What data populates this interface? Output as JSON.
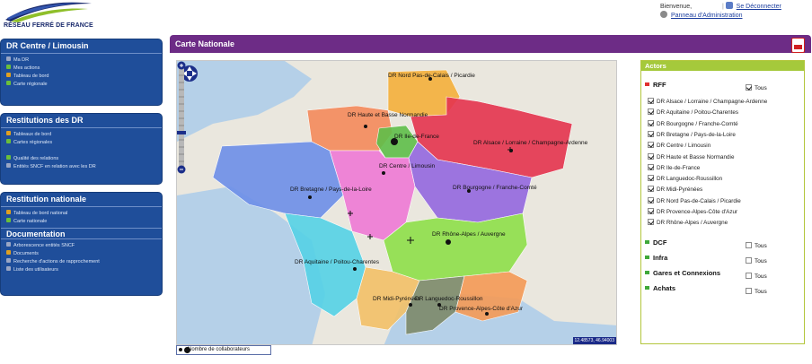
{
  "header": {
    "logo_text": "RÉSEAU FERRÉ DE FRANCE",
    "welcome": "Bienvenue,",
    "logout": "Se Déconnecter",
    "admin": "Panneau d'Administration"
  },
  "sidebar": {
    "panels": [
      {
        "title": "DR Centre / Limousin",
        "items": [
          {
            "label": "Ma DR",
            "color": "#9aa6c4"
          },
          {
            "label": "Mes actions",
            "color": "#6bbf3a"
          },
          {
            "label": "Tableau de bord",
            "color": "#e0a020"
          },
          {
            "label": "Carte régionale",
            "color": "#6bbf3a"
          }
        ]
      },
      {
        "title": "Restitutions des DR",
        "items": [
          {
            "label": "Tableaux de bord",
            "color": "#e0a020"
          },
          {
            "label": "Cartes régionales",
            "color": "#6bbf3a"
          },
          {
            "label": "",
            "color": ""
          },
          {
            "label": "Qualité des relations",
            "color": "#6bbf3a"
          },
          {
            "label": "Entités SNCF en relation avec les DR",
            "color": "#9aa6c4"
          }
        ]
      },
      {
        "title": "Restitution nationale",
        "items": [
          {
            "label": "Tableau de bord national",
            "color": "#e0a020"
          },
          {
            "label": "Carte nationale",
            "color": "#6bbf3a"
          }
        ],
        "sub_title": "Documentation",
        "sub_items": [
          {
            "label": "Arborescence entités SNCF",
            "color": "#9aa6c4"
          },
          {
            "label": "Documents",
            "color": "#e0a020"
          },
          {
            "label": "Recherche d'actions de rapprochement",
            "color": "#9aa6c4"
          },
          {
            "label": "Liste des utilisateurs",
            "color": "#9aa6c4"
          }
        ]
      }
    ]
  },
  "main": {
    "title": "Carte Nationale",
    "map": {
      "coords": "12.48573, 46.94003",
      "regions": [
        {
          "label": "DR Nord Pas-de-Calais / Picardie",
          "color": "#f4b03c"
        },
        {
          "label": "DR Haute et Basse Normandie",
          "color": "#f48a5c"
        },
        {
          "label": "DR Ile-de-France",
          "color": "#5fbf4a"
        },
        {
          "label": "DR Alsace / Lorraine / Champagne-Ardenne",
          "color": "#e5344f"
        },
        {
          "label": "DR Centre / Limousin",
          "color": "#ef7ad6"
        },
        {
          "label": "DR Bretagne / Pays-de-la-Loire",
          "color": "#6d8fe8"
        },
        {
          "label": "DR Bourgogne / Franche-Comté",
          "color": "#9468e0"
        },
        {
          "label": "DR Aquitaine / Poitou-Charentes",
          "color": "#55d2e6"
        },
        {
          "label": "DR Rhône-Alpes / Auvergne",
          "color": "#8fe04a"
        },
        {
          "label": "DR Midi-Pyrénées",
          "color": "#f3c168"
        },
        {
          "label": "DR Languedoc-Roussillon",
          "color": "#7d8a6a"
        },
        {
          "label": "DR Provence-Alpes-Côte d'Azur",
          "color": "#f59a56"
        }
      ]
    },
    "legend": "Nombre de collaborateurs"
  },
  "actors": {
    "title": "Actors",
    "groups": [
      {
        "name": "RFF",
        "marker": "#e03030",
        "tous": "Tous",
        "tous_checked": true,
        "items": [
          {
            "label": "DR Alsace / Lorraine / Champagne-Ardenne",
            "checked": true
          },
          {
            "label": "DR Aquitaine / Poitou-Charentes",
            "checked": true
          },
          {
            "label": "DR Bourgogne / Franche-Comté",
            "checked": true
          },
          {
            "label": "DR Bretagne / Pays-de-la-Loire",
            "checked": true
          },
          {
            "label": "DR Centre / Limousin",
            "checked": true
          },
          {
            "label": "DR Haute et Basse Normandie",
            "checked": true
          },
          {
            "label": "DR Ile-de-France",
            "checked": true
          },
          {
            "label": "DR Languedoc-Roussillon",
            "checked": true
          },
          {
            "label": "DR Midi-Pyrénées",
            "checked": true
          },
          {
            "label": "DR Nord Pas-de-Calais / Picardie",
            "checked": true
          },
          {
            "label": "DR Provence-Alpes-Côte d'Azur",
            "checked": true
          },
          {
            "label": "DR Rhône-Alpes / Auvergne",
            "checked": true
          }
        ]
      },
      {
        "name": "DCF",
        "marker": "#3fa83a",
        "tous": "Tous",
        "tous_checked": false
      },
      {
        "name": "Infra",
        "marker": "#3fa83a",
        "tous": "Tous",
        "tous_checked": false
      },
      {
        "name": "Gares et Connexions",
        "marker": "#3fa83a",
        "tous": "Tous",
        "tous_checked": false
      },
      {
        "name": "Achats",
        "marker": "#3fa83a",
        "tous": "Tous",
        "tous_checked": false
      }
    ]
  }
}
